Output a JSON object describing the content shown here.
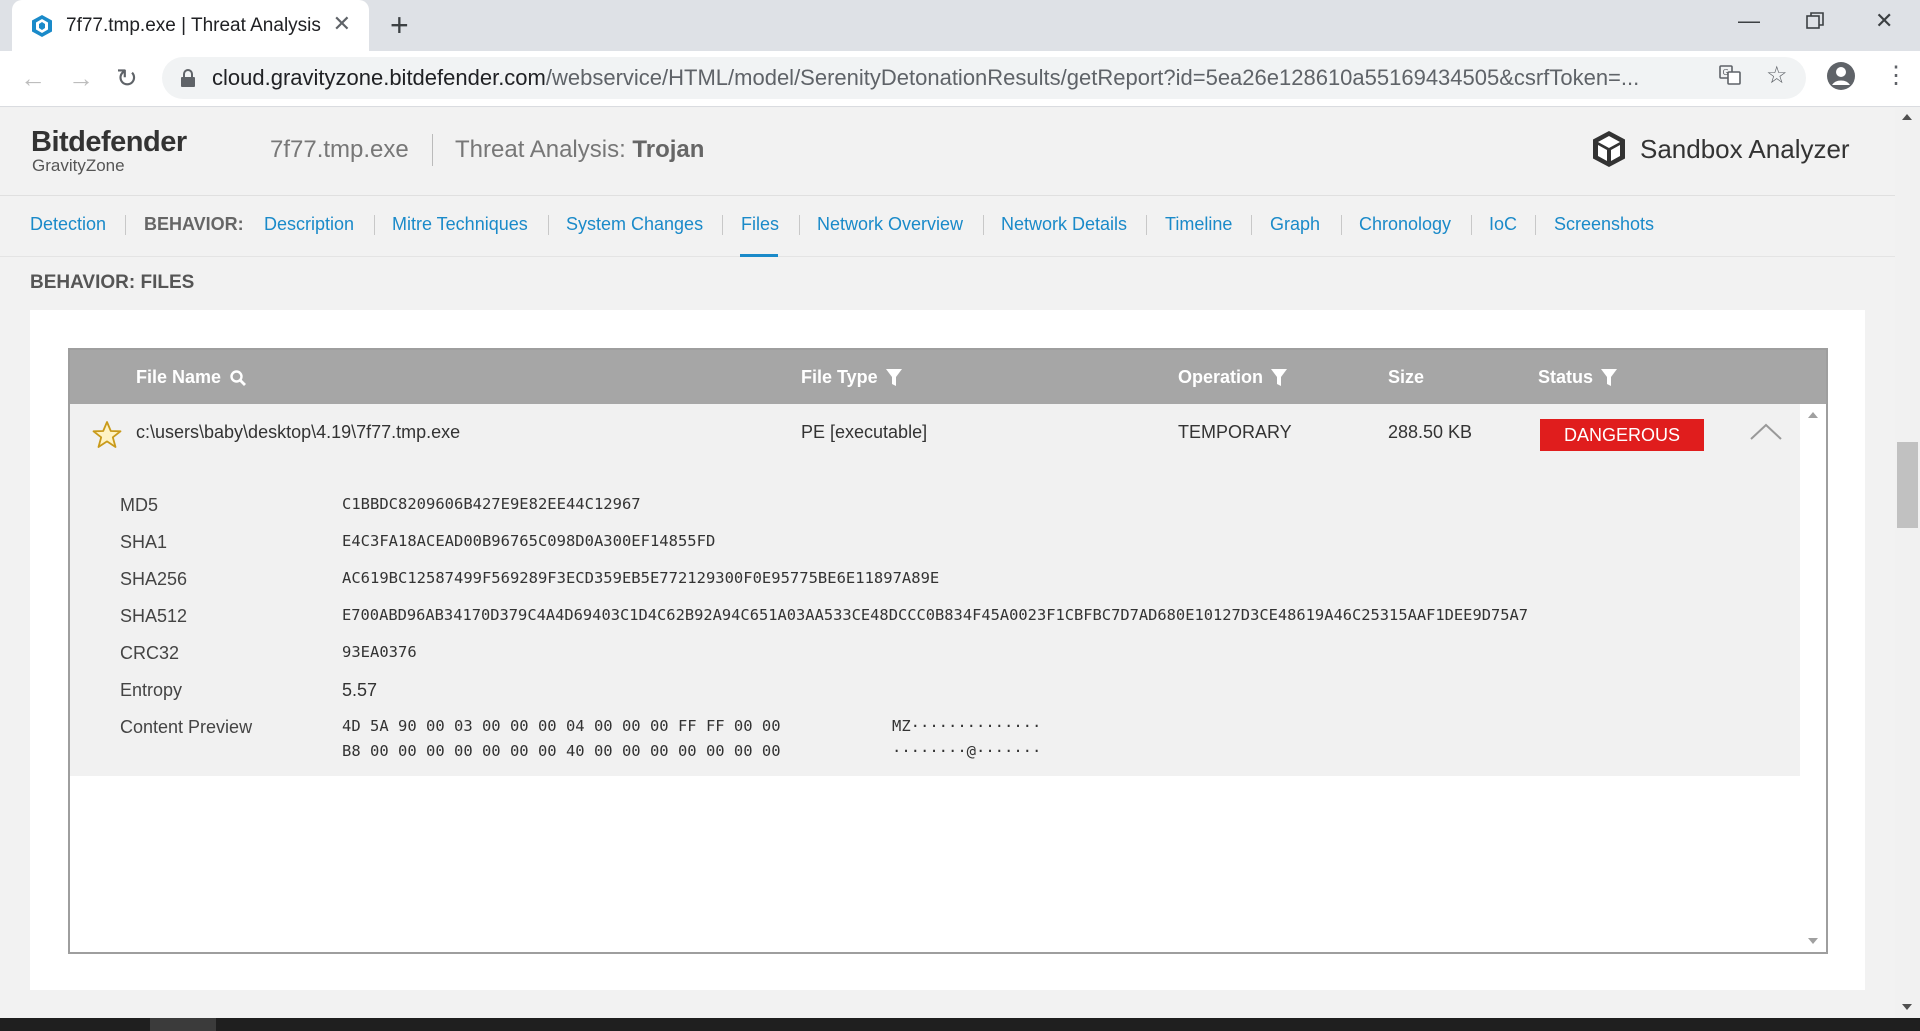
{
  "browser": {
    "tab_title": "7f77.tmp.exe | Threat Analysis",
    "url_host": "cloud.gravityzone.bitdefender.com",
    "url_path": "/webservice/HTML/model/SerenityDetonationResults/getReport?id=5ea26e128610a55169434505&csrfToken=..."
  },
  "header": {
    "brand": "Bitdefender",
    "brand_sub": "GravityZone",
    "file_name": "7f77.tmp.exe",
    "threat_prefix": "Threat Analysis: ",
    "threat_name": "Trojan",
    "product": "Sandbox Analyzer"
  },
  "nav": {
    "detection": "Detection",
    "behavior_label": "BEHAVIOR:",
    "items": [
      "Description",
      "Mitre Techniques",
      "System Changes",
      "Files",
      "Network Overview",
      "Network Details",
      "Timeline",
      "Graph",
      "Chronology",
      "IoC",
      "Screenshots"
    ],
    "active": "Files"
  },
  "section_title": "BEHAVIOR: FILES",
  "table": {
    "columns": [
      "File Name",
      "File Type",
      "Operation",
      "Size",
      "Status"
    ],
    "row": {
      "file_name": "c:\\users\\baby\\desktop\\4.19\\7f77.tmp.exe",
      "file_type": "PE [executable]",
      "operation": "TEMPORARY",
      "size": "288.50 KB",
      "status": "DANGEROUS"
    },
    "details": {
      "md5_label": "MD5",
      "md5": "C1BBDC8209606B427E9E82EE44C12967",
      "sha1_label": "SHA1",
      "sha1": "E4C3FA18ACEAD00B96765C098D0A300EF14855FD",
      "sha256_label": "SHA256",
      "sha256": "AC619BC12587499F569289F3ECD359EB5E772129300F0E95775BE6E11897A89E",
      "sha512_label": "SHA512",
      "sha512": "E700ABD96AB34170D379C4A4D69403C1D4C62B92A94C651A03AA533CE48DCCC0B834F45A0023F1CBFBC7D7AD680E10127D3CE48619A46C25315AAF1DEE9D75A7",
      "crc32_label": "CRC32",
      "crc32": "93EA0376",
      "entropy_label": "Entropy",
      "entropy": "5.57",
      "preview_label": "Content Preview",
      "hex_line1": "4D 5A 90 00 03 00 00 00 04 00 00 00 FF FF 00 00",
      "ascii_line1": "MZ··············",
      "hex_line2": "B8 00 00 00 00 00 00 00 40 00 00 00 00 00 00 00",
      "ascii_line2": "········@·······"
    }
  },
  "colors": {
    "accent": "#1a8ac9",
    "danger": "#e01d1d",
    "table_header": "#a6a6a6"
  }
}
